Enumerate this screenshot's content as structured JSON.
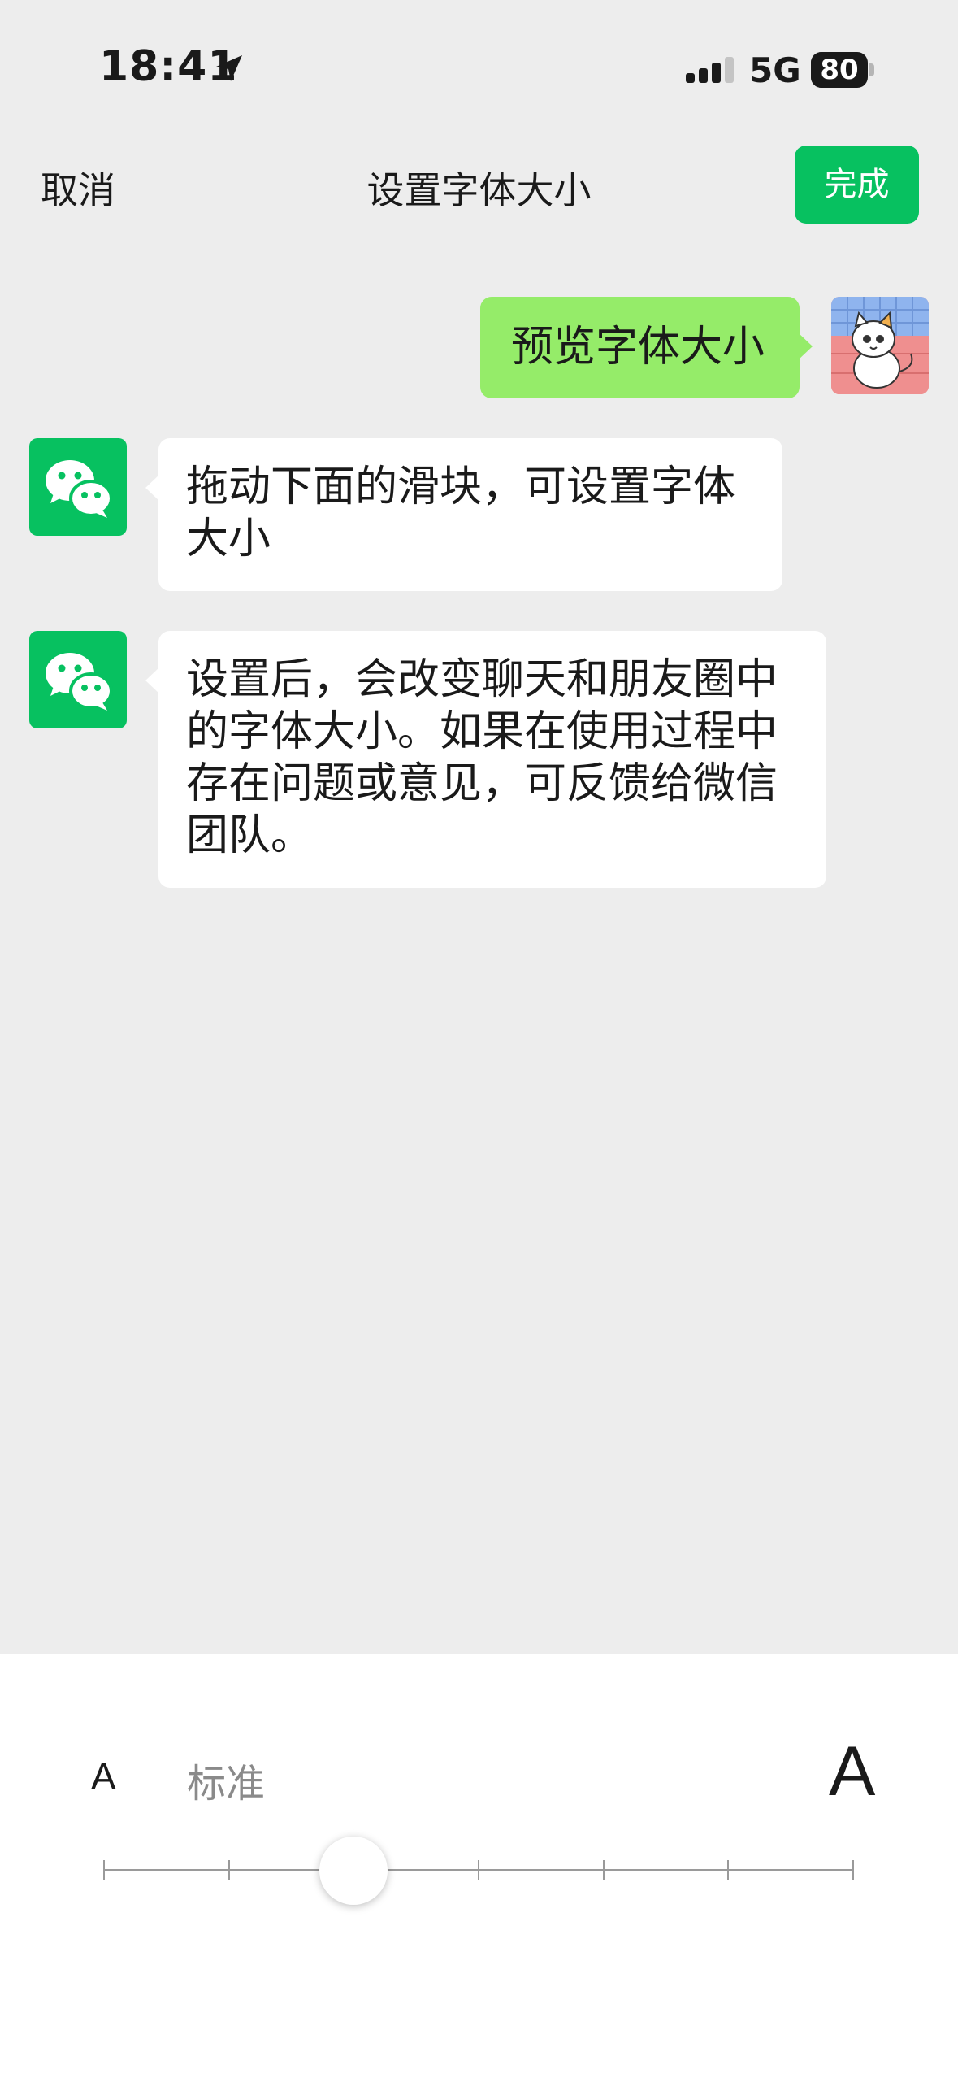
{
  "status_bar": {
    "time": "18:41",
    "network": "5G",
    "battery": "80",
    "battery_level": 0.8
  },
  "nav": {
    "cancel_label": "取消",
    "title": "设置字体大小",
    "done_label": "完成"
  },
  "chat": [
    {
      "sender": "me",
      "text": "预览字体大小"
    },
    {
      "sender": "wechat",
      "text": "拖动下面的滑块，可设置字体大小"
    },
    {
      "sender": "wechat",
      "text": "设置后，会改变聊天和朋友圈中的字体大小。如果在使用过程中存在问题或意见，可反馈给微信团队。"
    }
  ],
  "font_size_panel": {
    "small_label": "A",
    "current_label": "标准",
    "large_label": "A",
    "slider": {
      "steps": 7,
      "selected_index": 2
    }
  },
  "colors": {
    "accent": "#07c160",
    "my_bubble": "#95ec69",
    "background": "#ededed"
  }
}
